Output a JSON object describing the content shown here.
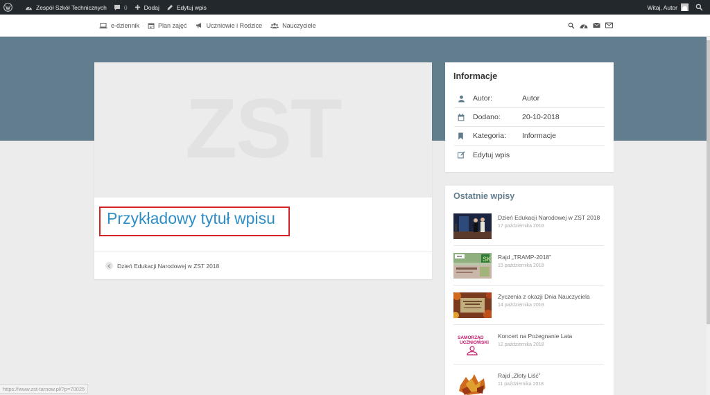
{
  "adminbar": {
    "site_name": "Zespół Szkół Technicznych",
    "comments_count": "0",
    "add_label": "Dodaj",
    "edit_label": "Edytuj wpis",
    "greeting": "Witaj, Autor"
  },
  "nav": {
    "items": [
      {
        "label": "e-dziennik",
        "icon": "laptop-icon"
      },
      {
        "label": "Plan zajęć",
        "icon": "calendar-icon"
      },
      {
        "label": "Uczniowie i Rodzice",
        "icon": "megaphone-icon"
      },
      {
        "label": "Nauczyciele",
        "icon": "users-icon"
      }
    ],
    "right_icons": [
      "search-icon",
      "dashboard-icon",
      "mail-icon",
      "envelope-icon"
    ]
  },
  "post": {
    "thumbnail_text": "ZST",
    "title": "Przykładowy tytuł wpisu",
    "prev_post_title": "Dzień Edukacji Narodowej w ZST 2018"
  },
  "info": {
    "heading": "Informacje",
    "rows": [
      {
        "label": "Autor:",
        "value": "Autor",
        "icon": "user-icon"
      },
      {
        "label": "Dodano:",
        "value": "20-10-2018",
        "icon": "calendar-icon"
      },
      {
        "label": "Kategoria:",
        "value": "Informacje",
        "icon": "bookmark-icon"
      },
      {
        "label": "Edytuj wpis",
        "value": "",
        "icon": "edit-icon"
      }
    ]
  },
  "recent": {
    "heading": "Ostatnie wpisy",
    "items": [
      {
        "title": "Dzień Edukacji Narodowej w ZST 2018",
        "date": "17 października 2018"
      },
      {
        "title": "Rajd „TRAMP-2018”",
        "date": "15 października 2018"
      },
      {
        "title": "Życzenia z okazji Dnia Nauczyciela",
        "date": "14 października 2018"
      },
      {
        "title": "Koncert na Pożegnanie Lata",
        "date": "12 października 2018"
      },
      {
        "title": "Rajd „Złoty Liść”",
        "date": "11 października 2018"
      }
    ]
  },
  "status_url": "https://www.zst-tarnow.pl/?p=70025",
  "colors": {
    "admin_bar": "#23282d",
    "hero": "#627d8d",
    "title_link": "#2f8ec7",
    "highlight_border": "#d42326"
  }
}
